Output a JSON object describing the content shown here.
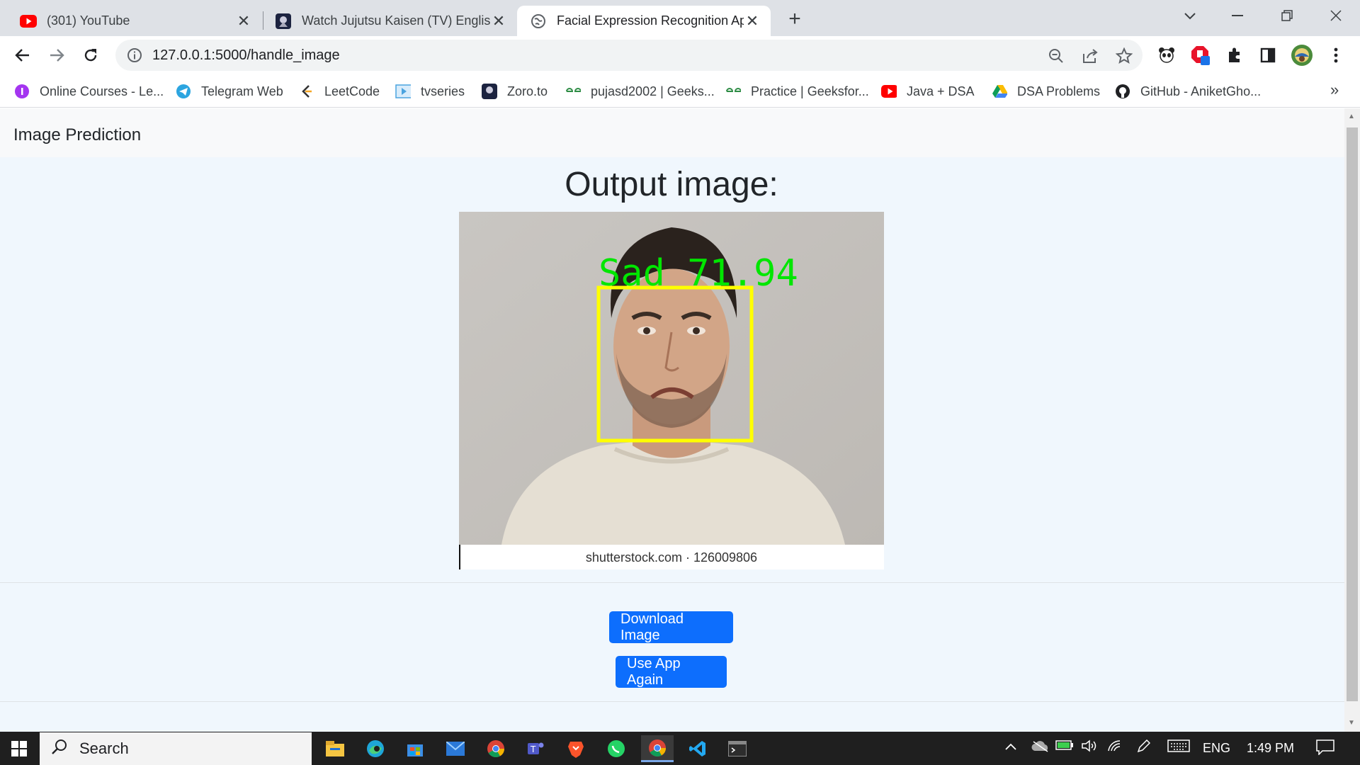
{
  "browser": {
    "tabs": [
      {
        "title": "(301) YouTube",
        "icon": "youtube-icon",
        "active": false
      },
      {
        "title": "Watch Jujutsu Kaisen (TV) English",
        "icon": "zoro-icon",
        "active": false
      },
      {
        "title": "Facial Expression Recognition Ap",
        "icon": "globe-icon",
        "active": true
      }
    ],
    "url": "127.0.0.1:5000/handle_image",
    "bookmarks": [
      {
        "label": "Online Courses - Le...",
        "icon": "courses-icon"
      },
      {
        "label": "Telegram Web",
        "icon": "telegram-icon"
      },
      {
        "label": "LeetCode",
        "icon": "leetcode-icon"
      },
      {
        "label": "tvseries",
        "icon": "tvseries-icon"
      },
      {
        "label": "Zoro.to",
        "icon": "zoro-icon"
      },
      {
        "label": "pujasd2002 | Geeks...",
        "icon": "gfg-icon"
      },
      {
        "label": "Practice | Geeksfor...",
        "icon": "gfg-icon"
      },
      {
        "label": "Java + DSA",
        "icon": "youtube-icon"
      },
      {
        "label": "DSA Problems",
        "icon": "drive-icon"
      },
      {
        "label": "GitHub - AniketGho...",
        "icon": "github-icon"
      }
    ],
    "more_bookmarks": "»"
  },
  "page": {
    "brand": "Image Prediction",
    "heading": "Output image:",
    "prediction_label": "Sad 71.94",
    "watermark": "shutterstock.com · 126009806",
    "download_button": "Download Image",
    "use_again_button": "Use App Again"
  },
  "taskbar": {
    "search_placeholder": "Search",
    "language": "ENG",
    "time": "1:49 PM"
  },
  "colors": {
    "primary_button": "#0d6efd",
    "page_bg": "#f0f7fd",
    "face_box": "#ffff00",
    "label_text": "#00e600"
  }
}
